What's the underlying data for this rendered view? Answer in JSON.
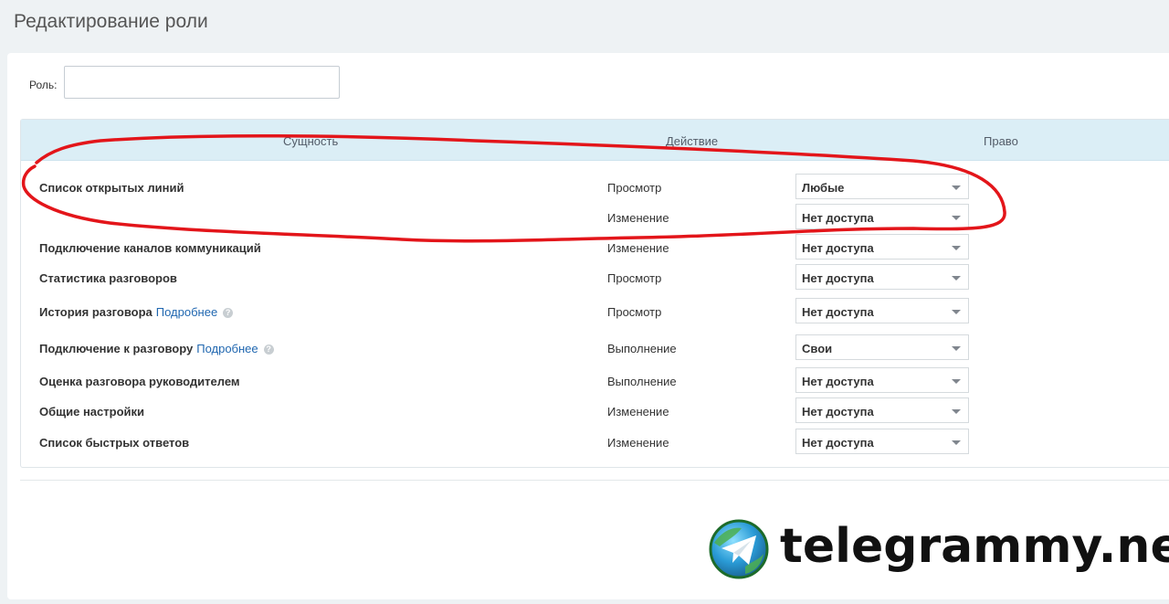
{
  "page": {
    "title": "Редактирование роли"
  },
  "role": {
    "label": "Роль:",
    "value": ""
  },
  "table": {
    "headers": {
      "entity": "Сущность",
      "action": "Действие",
      "right": "Право"
    },
    "rows": [
      {
        "entity": "Список открытых линий",
        "link": "",
        "action": "Просмотр",
        "right": "Любые"
      },
      {
        "entity": "",
        "link": "",
        "action": "Изменение",
        "right": "Нет доступа"
      },
      {
        "entity": "Подключение каналов коммуникаций",
        "link": "",
        "action": "Изменение",
        "right": "Нет доступа"
      },
      {
        "entity": "Статистика разговоров",
        "link": "",
        "action": "Просмотр",
        "right": "Нет доступа"
      },
      {
        "entity": "История разговора",
        "link": "Подробнее",
        "action": "Просмотр",
        "right": "Нет доступа"
      },
      {
        "entity": "Подключение к разговору",
        "link": "Подробнее",
        "action": "Выполнение",
        "right": "Свои"
      },
      {
        "entity": "Оценка разговора руководителем",
        "link": "",
        "action": "Выполнение",
        "right": "Нет доступа"
      },
      {
        "entity": "Общие настройки",
        "link": "",
        "action": "Изменение",
        "right": "Нет доступа"
      },
      {
        "entity": "Список быстрых ответов",
        "link": "",
        "action": "Изменение",
        "right": "Нет доступа"
      }
    ]
  },
  "watermark": {
    "text": "telegrammy.net",
    "icon": "telegram-logo"
  },
  "colors": {
    "header_bg": "#dbeef6",
    "link": "#2067b0",
    "annotation": "#e3151a"
  }
}
